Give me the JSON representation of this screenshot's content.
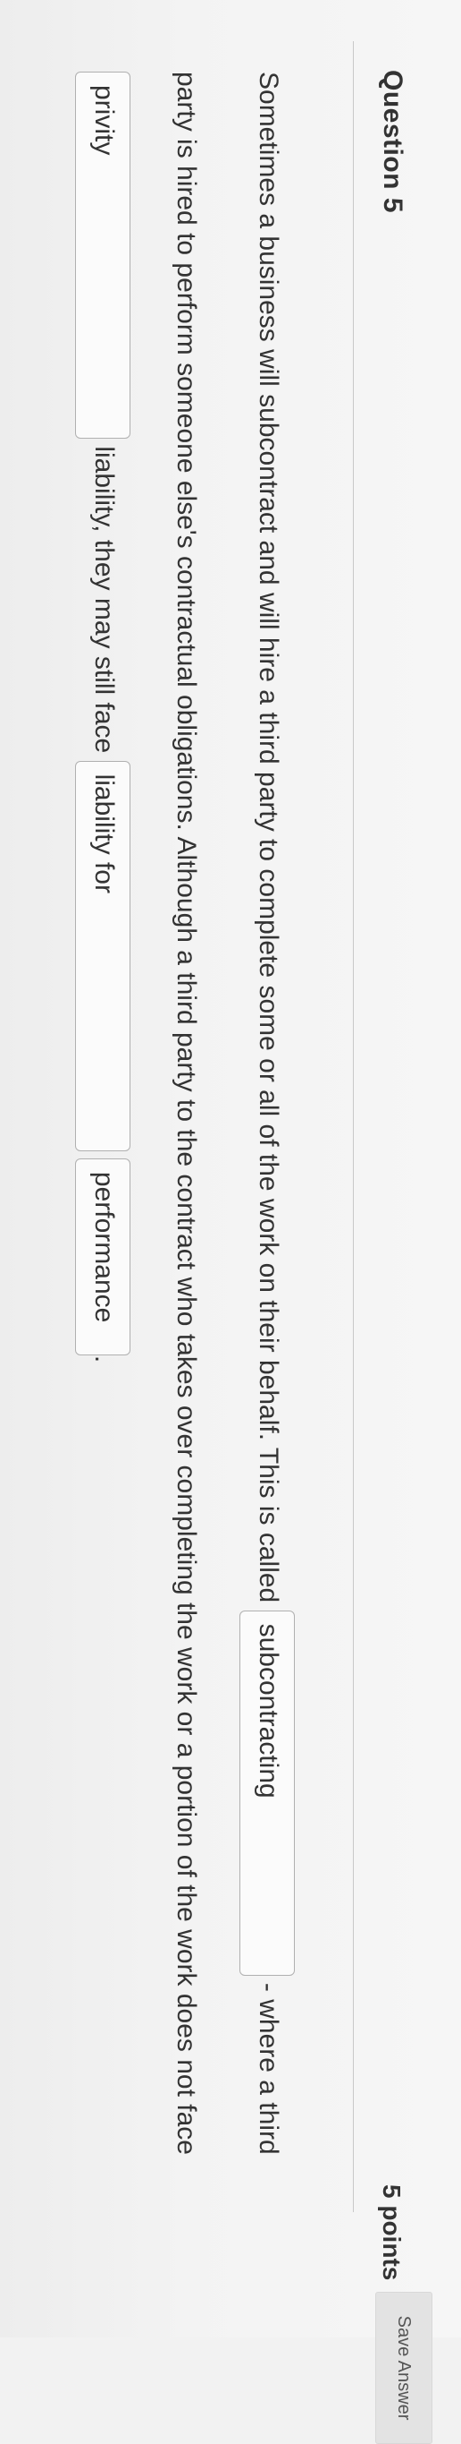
{
  "question": {
    "title": "Question 5",
    "points": "5 points",
    "save_label": "Save Answer"
  },
  "body": {
    "part1": "Sometimes a business will subcontract and will hire a third party to complete some or all of the work on their behalf. This is called",
    "part2": "- where a third party is hired to perform someone else's contractual obligations. Although a third party to the contract who takes over completing the work or a portion of the work does not face",
    "part3": "liability, they may still face",
    "part4": ".",
    "answers": [
      "subcontracting",
      "privity",
      "liability for",
      "performance"
    ]
  }
}
